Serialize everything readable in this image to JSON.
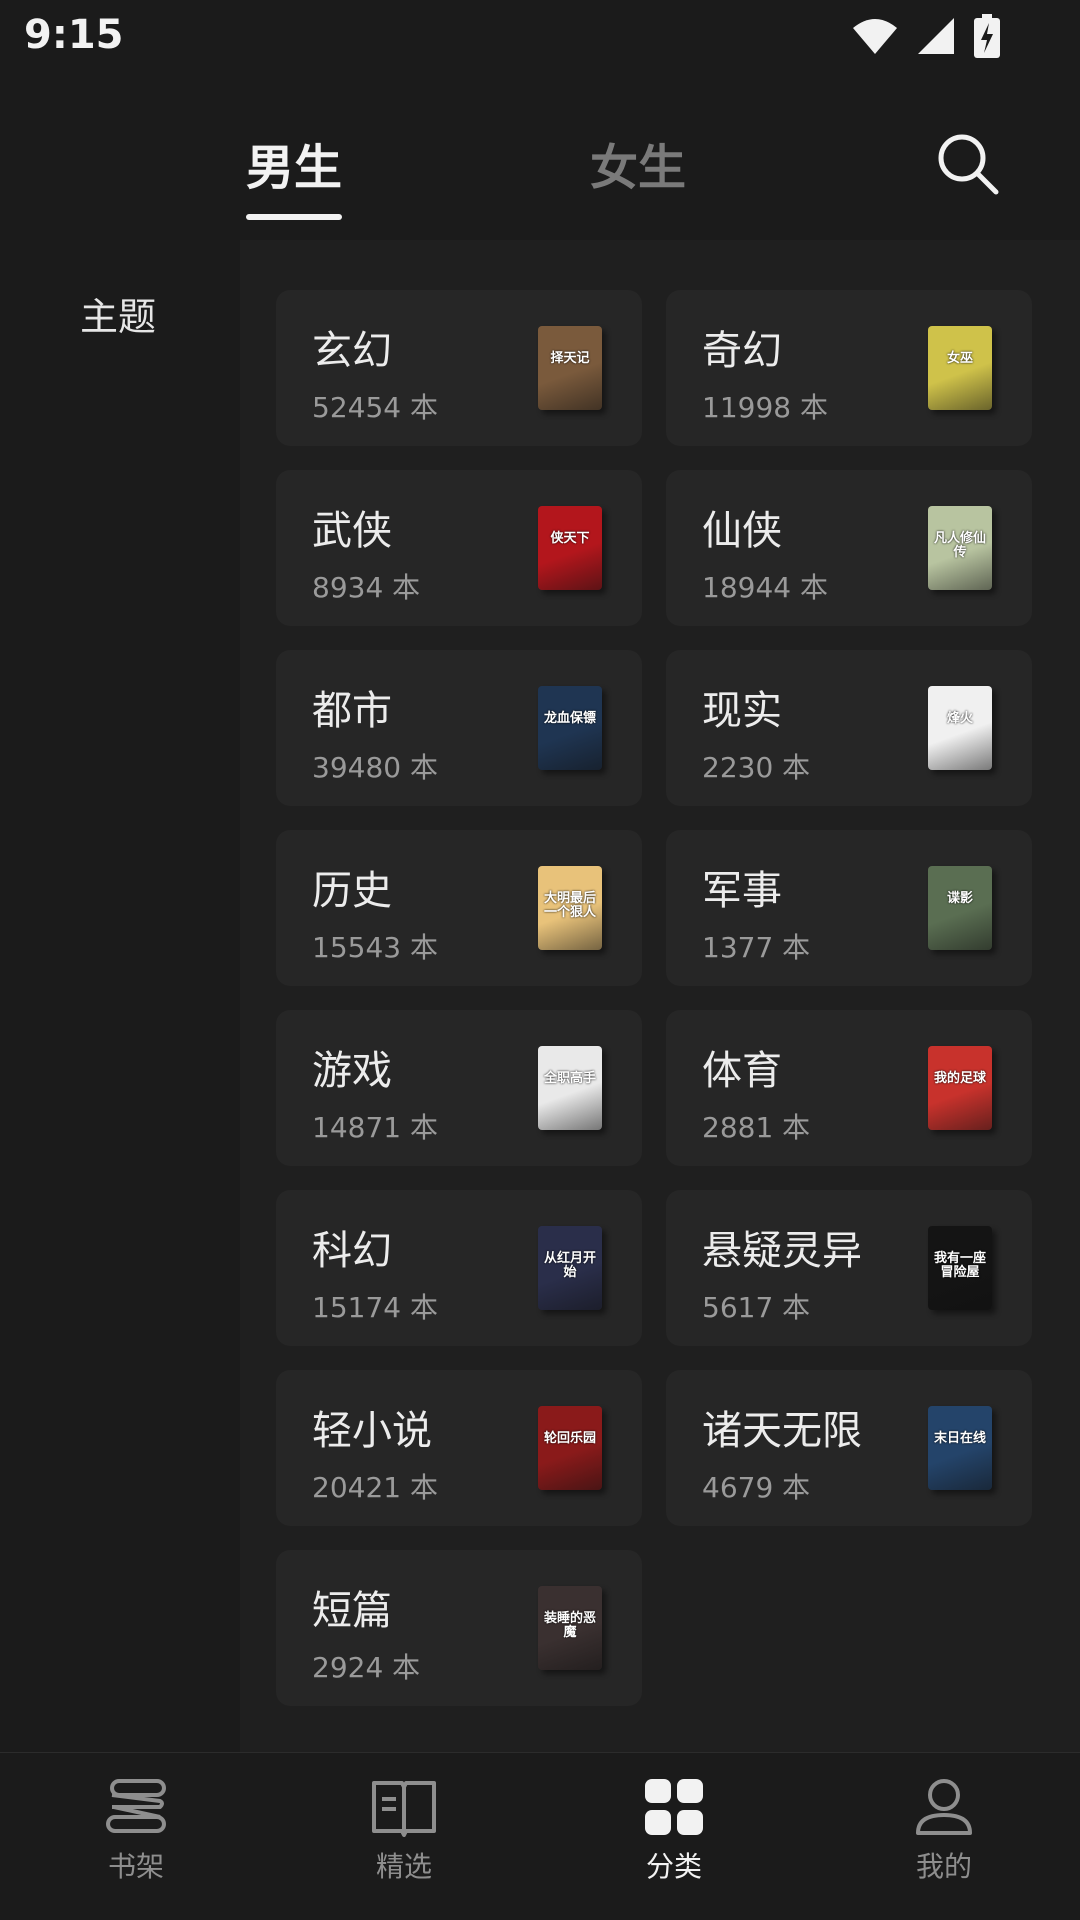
{
  "status_bar": {
    "time": "9:15"
  },
  "header": {
    "tabs": [
      {
        "label": "男生",
        "active": true
      },
      {
        "label": "女生",
        "active": false
      }
    ]
  },
  "side": {
    "section_label": "主题"
  },
  "categories": [
    {
      "title": "玄幻",
      "count": "52454 本",
      "cover_text": "择天记",
      "cover_color": "#7a5a3c"
    },
    {
      "title": "奇幻",
      "count": "11998 本",
      "cover_text": "女巫",
      "cover_color": "#cfc24a"
    },
    {
      "title": "武侠",
      "count": "8934 本",
      "cover_text": "侠天下",
      "cover_color": "#b3161c"
    },
    {
      "title": "仙侠",
      "count": "18944 本",
      "cover_text": "凡人修仙传",
      "cover_color": "#b8c4a0"
    },
    {
      "title": "都市",
      "count": "39480 本",
      "cover_text": "龙血保镖",
      "cover_color": "#1f3552"
    },
    {
      "title": "现实",
      "count": "2230 本",
      "cover_text": "烽火",
      "cover_color": "#f0f0f0"
    },
    {
      "title": "历史",
      "count": "15543 本",
      "cover_text": "大明最后一个狠人",
      "cover_color": "#e8c27a"
    },
    {
      "title": "军事",
      "count": "1377 本",
      "cover_text": "谍影",
      "cover_color": "#5a6e52"
    },
    {
      "title": "游戏",
      "count": "14871 本",
      "cover_text": "全职高手",
      "cover_color": "#e9e9e9"
    },
    {
      "title": "体育",
      "count": "2881 本",
      "cover_text": "我的足球",
      "cover_color": "#c8322c"
    },
    {
      "title": "科幻",
      "count": "15174 本",
      "cover_text": "从红月开始",
      "cover_color": "#2a2e4a"
    },
    {
      "title": "悬疑灵异",
      "count": "5617 本",
      "cover_text": "我有一座冒险屋",
      "cover_color": "#141414"
    },
    {
      "title": "轻小说",
      "count": "20421 本",
      "cover_text": "轮回乐园",
      "cover_color": "#8a1a1a"
    },
    {
      "title": "诸天无限",
      "count": "4679 本",
      "cover_text": "末日在线",
      "cover_color": "#24446a"
    },
    {
      "title": "短篇",
      "count": "2924 本",
      "cover_text": "装睡的恶魔",
      "cover_color": "#3a3030"
    }
  ],
  "bottom_nav": [
    {
      "label": "书架",
      "icon": "bookshelf-icon",
      "active": false
    },
    {
      "label": "精选",
      "icon": "open-book-icon",
      "active": false
    },
    {
      "label": "分类",
      "icon": "grid-icon",
      "active": true
    },
    {
      "label": "我的",
      "icon": "person-icon",
      "active": false
    }
  ],
  "colors": {
    "background": "#1b1b1b",
    "card": "#262626",
    "active": "#f2f2f2",
    "inactive": "#8e8e8e"
  }
}
